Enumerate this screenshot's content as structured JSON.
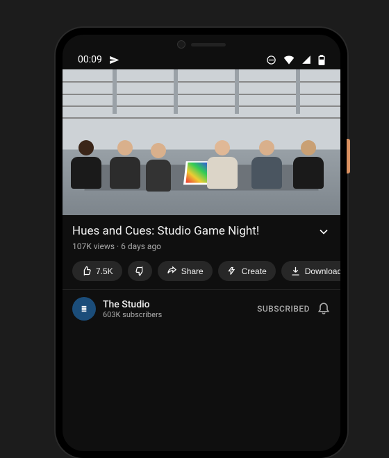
{
  "statusbar": {
    "time": "00:09"
  },
  "video": {
    "title": "Hues and Cues: Studio Game Night!",
    "views": "107K views",
    "age": "6 days ago"
  },
  "actions": {
    "likes": "7.5K",
    "share": "Share",
    "create": "Create",
    "download": "Download"
  },
  "channel": {
    "name": "The Studio",
    "subs": "603K subscribers",
    "state": "SUBSCRIBED"
  },
  "colors": {
    "accent": "#272727"
  }
}
